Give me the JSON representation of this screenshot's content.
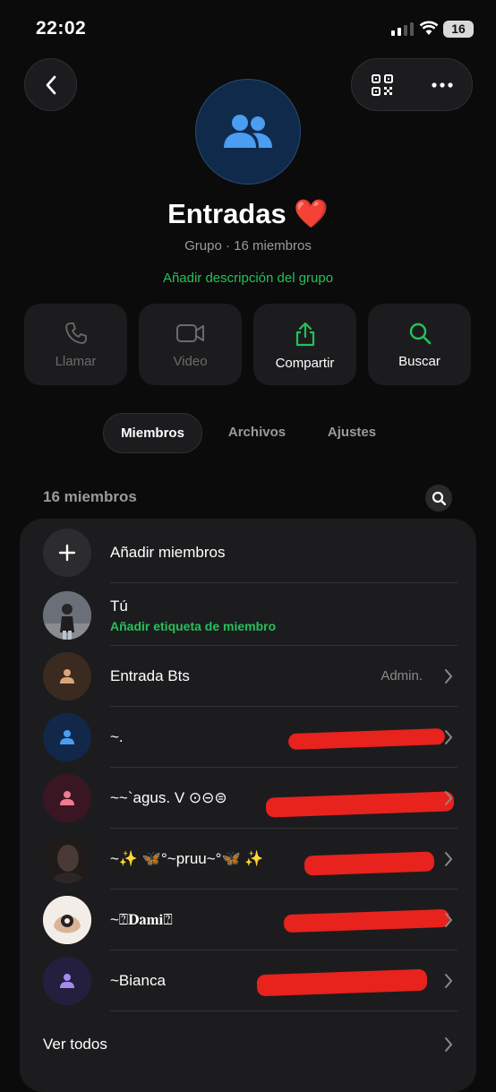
{
  "status_bar": {
    "time": "22:02",
    "battery": "16"
  },
  "group": {
    "title": "Entradas ❤️",
    "subtitle": "Grupo · 16 miembros",
    "add_description": "Añadir descripción del grupo"
  },
  "actions": [
    {
      "label": "Llamar",
      "icon": "phone-icon",
      "enabled": false
    },
    {
      "label": "Video",
      "icon": "video-icon",
      "enabled": false
    },
    {
      "label": "Compartir",
      "icon": "share-icon",
      "enabled": true
    },
    {
      "label": "Buscar",
      "icon": "search-icon",
      "enabled": true
    }
  ],
  "tabs": [
    {
      "label": "Miembros",
      "active": true
    },
    {
      "label": "Archivos",
      "active": false
    },
    {
      "label": "Ajustes",
      "active": false
    }
  ],
  "members_count": "16 miembros",
  "members": {
    "add_label": "Añadir miembros",
    "you_name": "Tú",
    "you_tag": "Añadir etiqueta de miembro",
    "list": [
      {
        "name": "Entrada Bts",
        "role": "Admin."
      },
      {
        "name": "~."
      },
      {
        "name": "~~`agus. V ⊙⊝⊜"
      },
      {
        "name": "~✨ 🦋°~pruu~°🦋 ✨"
      },
      {
        "name": "~⍰𝐃𝐚𝐦𝐢⍰"
      },
      {
        "name": "~Bianca"
      }
    ],
    "see_all": "Ver todos"
  },
  "colors": {
    "accent": "#25c15a",
    "background": "#0b0b0b",
    "card": "#1c1c1e",
    "avatar_blue": "#4a9df0"
  }
}
